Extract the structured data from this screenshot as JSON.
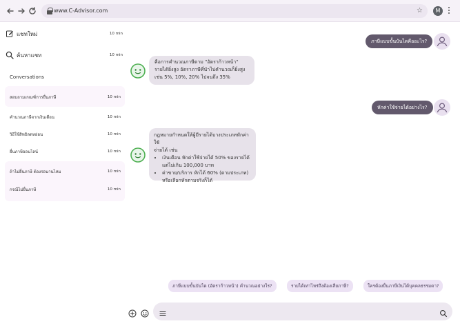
{
  "browser": {
    "url": "www.C-Advisor.com",
    "profile_initial": "M"
  },
  "sidebar": {
    "new_chat": {
      "label": "แชทใหม่",
      "time": "10 min"
    },
    "search": {
      "label": "ค้นหาแชท",
      "time": "10 min"
    },
    "conversations_title": "Conversations",
    "items": [
      {
        "label": "สอบถามเกณฑ์การยื่นภาษี",
        "time": "10 min"
      },
      {
        "label": "คำนวณภาษีจากเงินเดือน",
        "time": "10 min"
      },
      {
        "label": "วิธีใช้สิทธิลดหย่อน",
        "time": "10 min"
      },
      {
        "label": "ยื่นภาษีออนไลน์",
        "time": "10 min"
      },
      {
        "label": "ถ้าไม่ยื่นภาษี ต้องรอนานไหม",
        "time": "10 min"
      },
      {
        "label": "กรณีไม่ยื่นภาษี",
        "time": "10 min"
      }
    ]
  },
  "chat": {
    "messages": [
      {
        "role": "user",
        "text": "ภาษีแบบขั้นบันไดคืออะไร?"
      },
      {
        "role": "bot",
        "lines": [
          "คือการคำนวณภาษีตาม \"อัตราก้าวหน้า\"",
          "รายได้ยิ่งสูง อัตราภาษีที่นำไปคำนวณก็ยิ่งสูง",
          "เช่น 5%, 10%, 20% ไปจนถึง 35%"
        ]
      },
      {
        "role": "user",
        "text": "หักค่าใช้จ่ายได้อย่างไร?"
      },
      {
        "role": "bot",
        "intro": [
          "กฎหมายกำหนดให้ผู้มีรายได้บางประเภทหักค่าใช้",
          "จ่ายได้ เช่น"
        ],
        "bullets": [
          [
            "เงินเดือน หักค่าใช้จ่ายได้ 50% ของรายได้",
            "แต่ไม่เกิน 100,000 บาท"
          ],
          [
            "ค่าขาย/บริการ หักได้ 60% (ตามประเภท)",
            "หรือเลือกหักตามจริงก็ได้"
          ]
        ]
      }
    ]
  },
  "suggestions": [
    "ภาษีแบบขั้นบันได (อัตราก้าวหน้า) คำนวณอย่างไร?",
    "รายได้เท่าไหร่ถึงต้องเสียภาษี?",
    "ใครต้องยื่นภาษีเงินได้บุคคลธรรมดา?"
  ],
  "icons": {
    "back": "arrow-left-icon",
    "forward": "arrow-right-icon",
    "reload": "reload-icon",
    "new_chat": "edit-icon",
    "search": "search-icon",
    "user_avatar": "person-icon",
    "bot_avatar": "robot-icon",
    "attach": "plus-circle-icon",
    "emoji": "smile-icon",
    "menu": "menu-icon",
    "input_search": "search-icon"
  },
  "colors": {
    "user_bubble": "#62596c",
    "bot_bubble": "#e7e2ea",
    "bot_green": "#4caf50",
    "accent_light": "#ece2f4"
  }
}
